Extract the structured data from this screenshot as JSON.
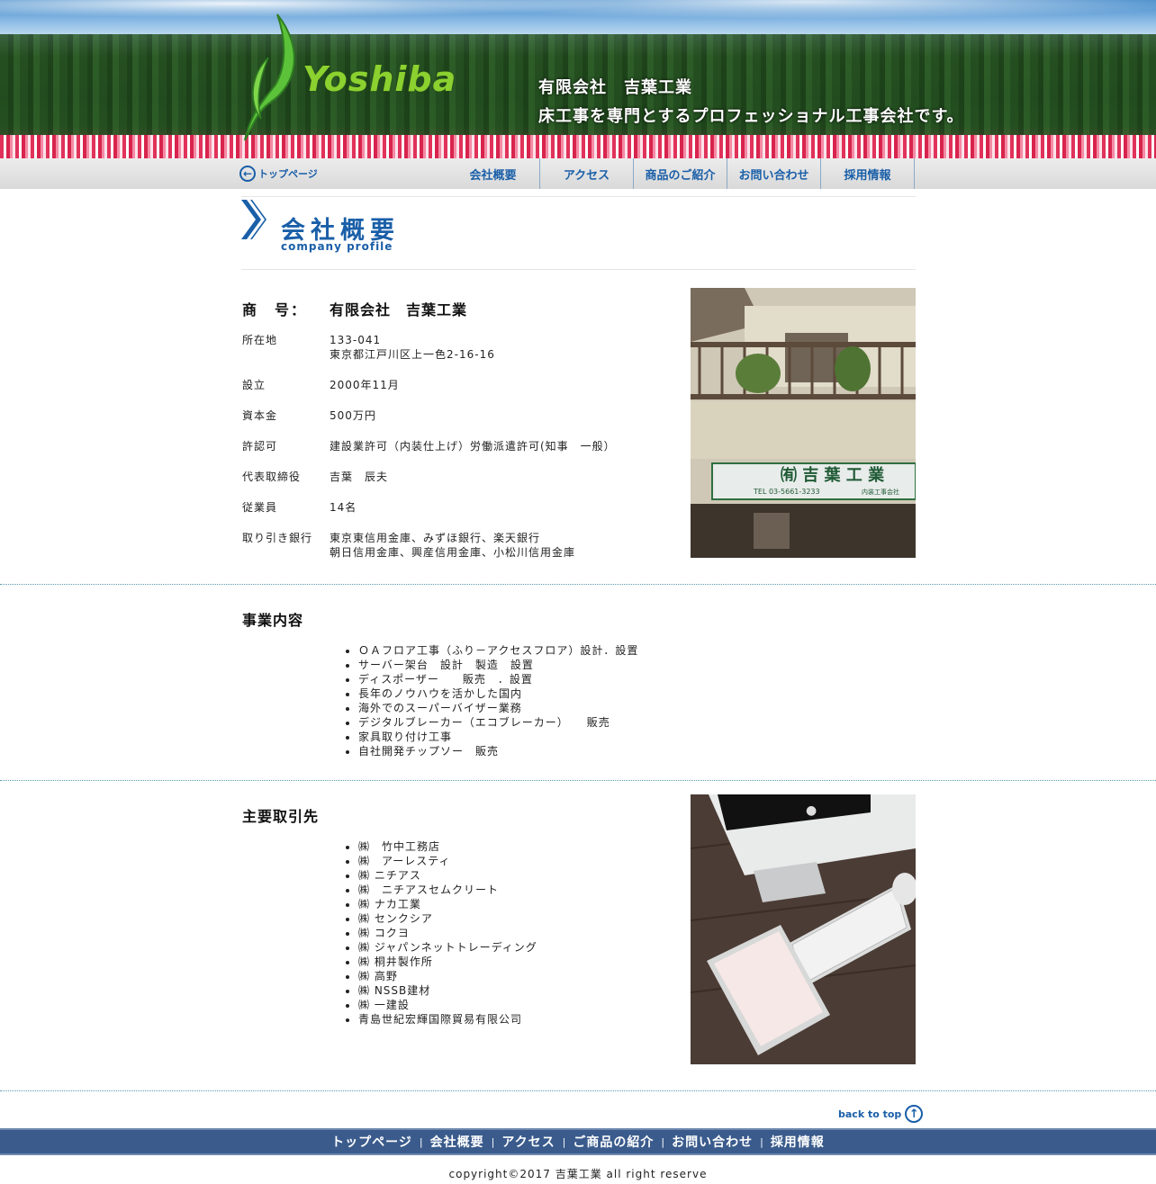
{
  "header": {
    "logo_text": "Yoshiba",
    "company_name": "有限会社　吉葉工業",
    "tagline": "床工事を専門とするプロフェッショナル工事会社です。"
  },
  "nav": {
    "top_link": "トップページ",
    "items": [
      "会社概要",
      "アクセス",
      "商品のご紹介",
      "お問い合わせ",
      "採用情報"
    ]
  },
  "page_title": {
    "jp": "会社概要",
    "en": "company profile"
  },
  "profile": {
    "company_label": "商　号：",
    "company_value": "有限会社　吉葉工業",
    "rows": [
      {
        "label": "所在地",
        "value": "133-041",
        "value2": "東京都江戸川区上一色2-16-16"
      },
      {
        "label": "設立",
        "value": "2000年11月"
      },
      {
        "label": "資本金",
        "value": "500万円"
      },
      {
        "label": "許認可",
        "value": "建設業許可（内装仕上げ）労働派遣許可(知事　一般）"
      },
      {
        "label": "代表取締役",
        "value": "吉葉　辰夫"
      },
      {
        "label": "従業員",
        "value": "14名"
      },
      {
        "label": "取り引き銀行",
        "value": "東京東信用金庫、みずほ銀行、楽天銀行",
        "value2": "朝日信用金庫、興産信用金庫、小松川信用金庫"
      }
    ],
    "sign_text": "㈲ 吉 葉 工 業",
    "sign_tel": "TEL 03-5661-3233",
    "sign_sub": "内装工事会社"
  },
  "business": {
    "title": "事業内容",
    "items": [
      "ＯＡフロア工事（ふり－アクセスフロア）設計．設置",
      "サーバー架台　設計　製造　設置",
      "ディスポーザー　　販売　．設置",
      "長年のノウハウを活かした国内",
      "海外でのスーパーバイザー業務",
      "デジタルブレーカー（エコブレーカー）　　販売",
      "家具取り付け工事",
      "自社開発チップソー　販売"
    ]
  },
  "clients": {
    "title": "主要取引先",
    "items": [
      "㈱　竹中工務店",
      "㈱　アーレスティ",
      "㈱ ニチアス",
      "㈱　ニチアスセムクリート",
      "㈱ ナカ工業",
      "㈱ センクシア",
      "㈱ コクヨ",
      "㈱ ジャパンネットトレーディング",
      "㈱ 桐井製作所",
      "㈱ 高野",
      "㈱ NSSB建材",
      "㈱ 一建設",
      "青島世紀宏輝国際貿易有限公司"
    ]
  },
  "back_to_top": "back to top",
  "footer": {
    "links": [
      "トップページ",
      "会社概要",
      "アクセス",
      "ご商品の紹介",
      "お問い合わせ",
      "採用情報"
    ],
    "copyright": "copyright©2017 吉葉工業 all right reserve"
  },
  "colors": {
    "brand_blue": "#1a5fa8",
    "footer_bg": "#3a5b8c",
    "logo_green": "#8bd12f"
  }
}
